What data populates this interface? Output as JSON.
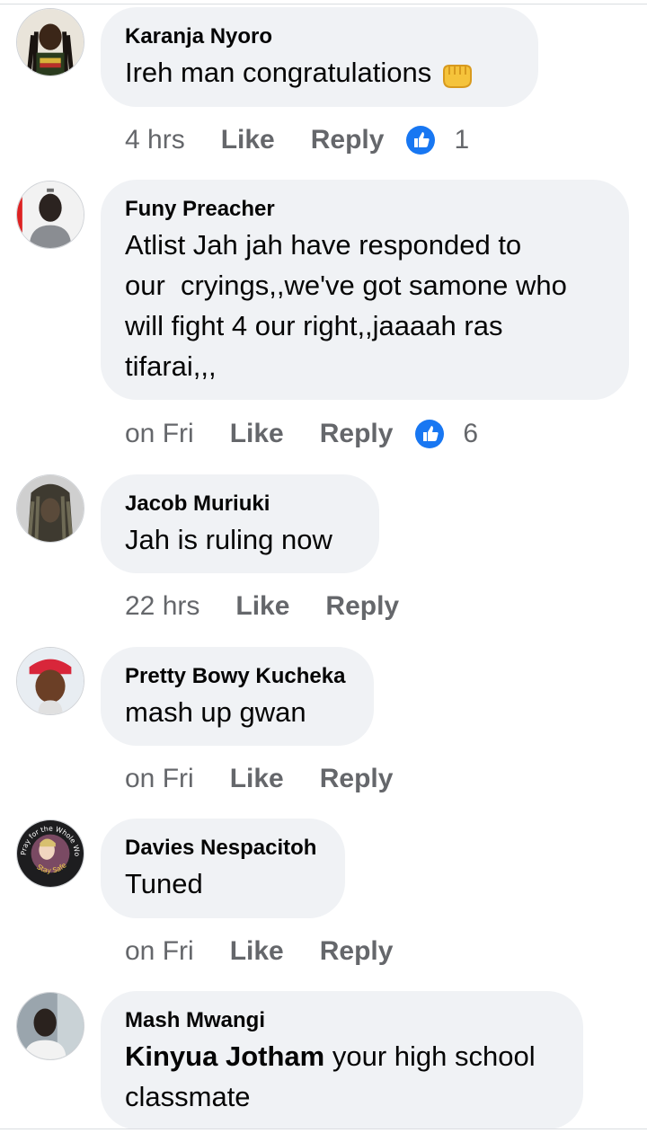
{
  "comments": [
    {
      "author": "Karanja Nyoro",
      "text_lines": [
        "Ireh man congratulations"
      ],
      "emoji": "raised-fist-emoji",
      "time": "4 hrs",
      "like_label": "Like",
      "reply_label": "Reply",
      "reaction_count": "1"
    },
    {
      "author": "Funy Preacher",
      "text_lines": [
        "Atlist Jah jah have responded to",
        "our  cryings,,we've got samone who",
        "will fight 4 our right,,jaaaah ras",
        "tifarai,,,"
      ],
      "time": "on Fri",
      "like_label": "Like",
      "reply_label": "Reply",
      "reaction_count": "6"
    },
    {
      "author": "Jacob Muriuki",
      "text_lines": [
        "Jah is ruling now"
      ],
      "time": "22 hrs",
      "like_label": "Like",
      "reply_label": "Reply"
    },
    {
      "author": "Pretty Bowy Kucheka",
      "text_lines": [
        "mash up gwan"
      ],
      "time": "on Fri",
      "like_label": "Like",
      "reply_label": "Reply"
    },
    {
      "author": "Davies Nespacitoh",
      "text_lines": [
        "Tuned"
      ],
      "avatar_text_top": "Pray for the Whole World",
      "avatar_text_bottom": "Stay Safe",
      "time": "on Fri",
      "like_label": "Like",
      "reply_label": "Reply"
    },
    {
      "author": "Mash Mwangi",
      "mention": "Kinyua Jotham",
      "text_after_mention": " your high school",
      "text_line2": "classmate"
    }
  ],
  "colors": {
    "bubble_bg": "#f0f2f5",
    "meta_text": "#65676b",
    "like_blue": "#1877f2"
  }
}
